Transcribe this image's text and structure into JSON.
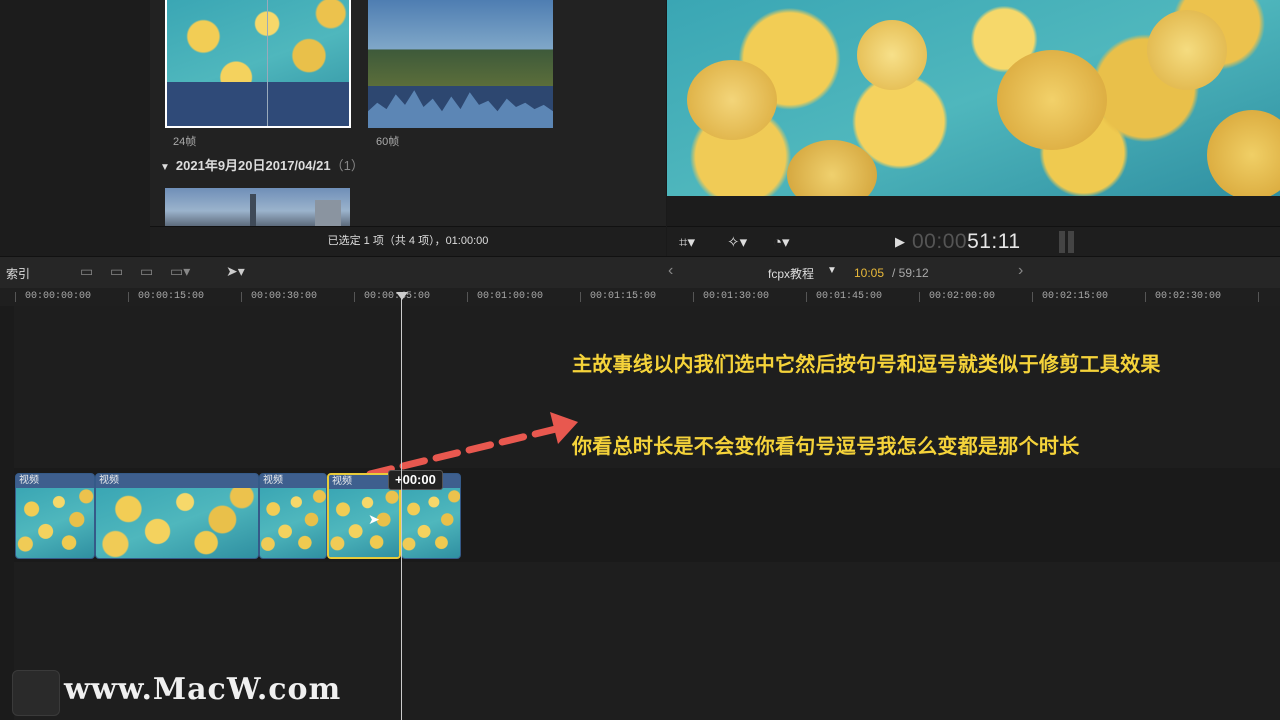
{
  "browser": {
    "clips": [
      {
        "label": "24帧",
        "type": "jellyfish",
        "selected": true
      },
      {
        "label": "60帧",
        "type": "temple",
        "selected": false
      }
    ],
    "event_disclosure": "▼",
    "event_title": "2021年9月20日2017/04/21",
    "event_count": "（1）",
    "status": "已选定 1 项（共 4 项），01:00:00"
  },
  "viewer": {
    "transform_icon": "crop-icon",
    "enhance_icon": "magic-wand-icon",
    "speed_icon": "speedometer-icon",
    "timecode_dim": "00:00",
    "timecode": "51:11"
  },
  "timeline_toolbar": {
    "index_label": "索引",
    "project_name": "fcpx教程",
    "position": "10:05",
    "duration": "/ 59:12",
    "prev": "‹",
    "next": "›"
  },
  "ruler": {
    "ticks": [
      "00:00:00:00",
      "00:00:15:00",
      "00:00:30:00",
      "00:00:45:00",
      "00:01:00:00",
      "00:01:15:00",
      "00:01:30:00",
      "00:01:45:00",
      "00:02:00:00",
      "00:02:15:00",
      "00:02:30:00"
    ]
  },
  "timeline": {
    "clips": [
      {
        "name": "视频",
        "selected": false
      },
      {
        "name": "视频",
        "selected": false
      },
      {
        "name": "视频",
        "selected": false
      },
      {
        "name": "视频",
        "selected": true
      },
      {
        "name": "",
        "selected": false
      }
    ],
    "trim_badge": "+00:00"
  },
  "captions": {
    "line1": "主故事线以内我们选中它然后按句号和逗号就类似于修剪工具效果",
    "line2": "你看总时长是不会变你看句号逗号我怎么变都是那个时长"
  },
  "watermark": "www.MacW.com",
  "colors": {
    "caption": "#f5d33a",
    "selection": "#e8cb3a",
    "arrow": "#e8584f",
    "clip_blue": "#3e5f8e"
  }
}
